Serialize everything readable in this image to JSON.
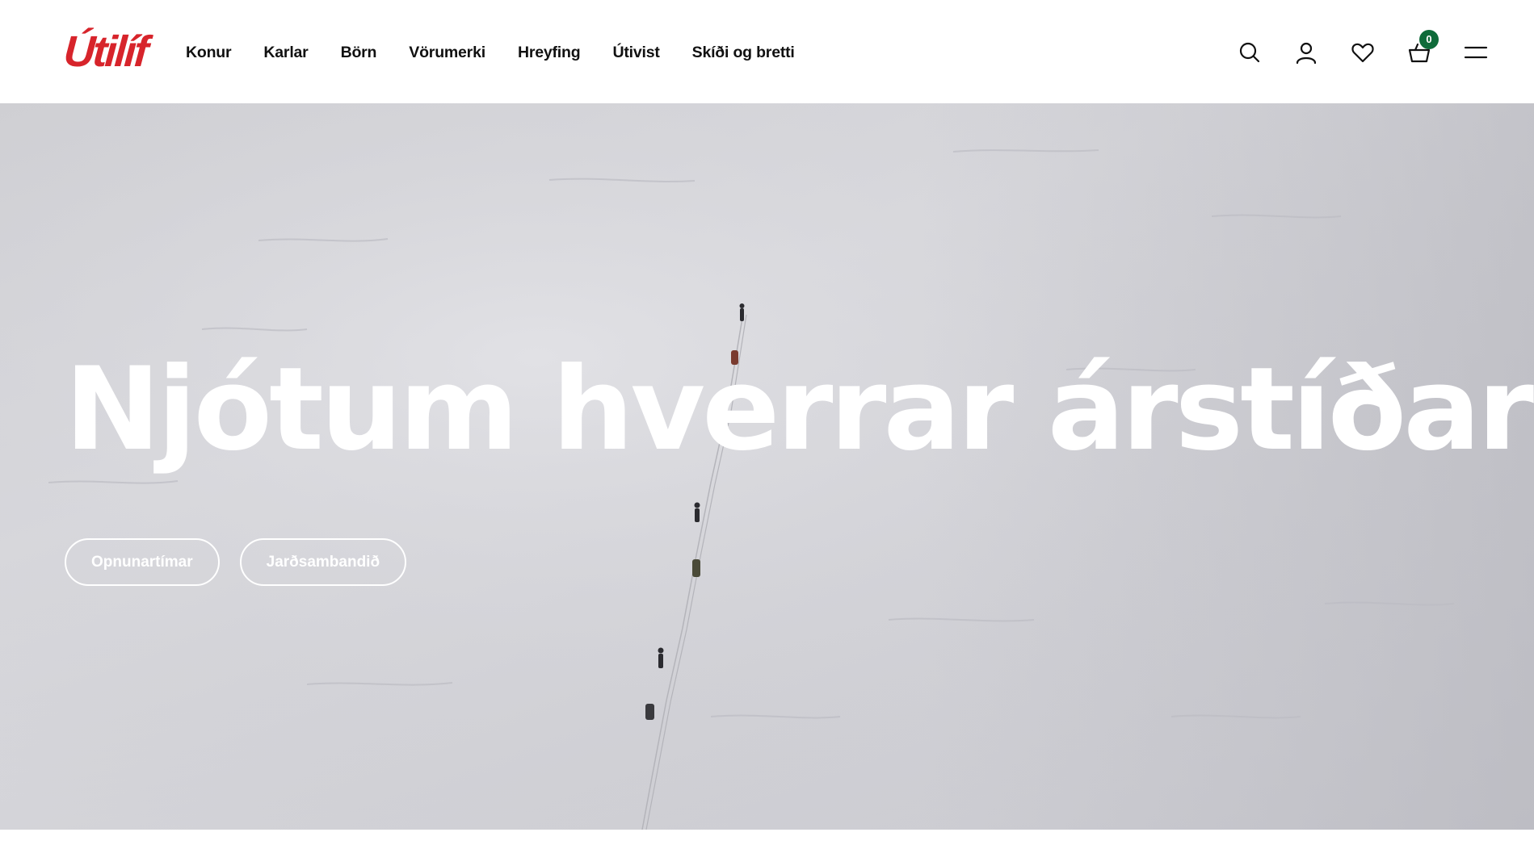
{
  "header": {
    "logo_text": "Útilíf",
    "nav": [
      {
        "label": "Konur"
      },
      {
        "label": "Karlar"
      },
      {
        "label": "Börn"
      },
      {
        "label": "Vörumerki"
      },
      {
        "label": "Hreyfing"
      },
      {
        "label": "Útivist"
      },
      {
        "label": "Skíði og bretti"
      }
    ],
    "icons": {
      "search": "search-icon",
      "account": "user-icon",
      "wishlist": "heart-icon",
      "cart": "basket-icon",
      "menu": "menu-icon"
    },
    "cart_count": "0"
  },
  "hero": {
    "headline": "Njótum hverrar árstíðar",
    "buttons": [
      {
        "label": "Opnunartímar"
      },
      {
        "label": "Jarðsambandið"
      }
    ]
  },
  "colors": {
    "brand_red": "#d7242b",
    "badge_green": "#0f6b3a",
    "text_dark": "#111111",
    "snow": "#d6d6db"
  }
}
